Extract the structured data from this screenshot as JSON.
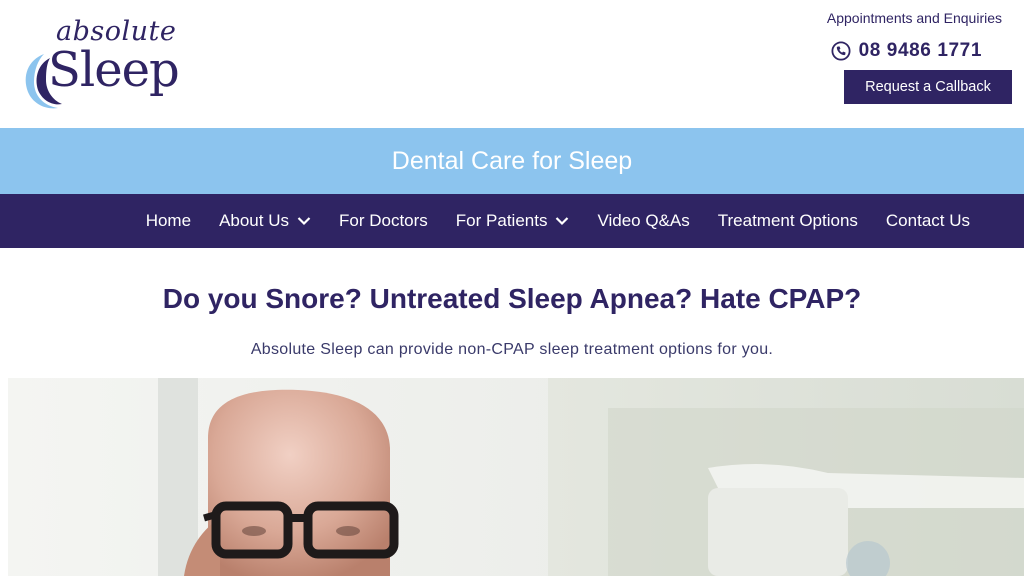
{
  "logo": {
    "line1": "absolute",
    "line2": "Sleep"
  },
  "contact": {
    "enquiries_label": "Appointments and Enquiries",
    "phone": "08 9486 1771",
    "callback_label": "Request a Callback"
  },
  "tagline": "Dental Care for Sleep",
  "nav": {
    "items": [
      {
        "label": "Home",
        "has_dropdown": false
      },
      {
        "label": "About Us",
        "has_dropdown": true
      },
      {
        "label": "For Doctors",
        "has_dropdown": false
      },
      {
        "label": "For Patients",
        "has_dropdown": true
      },
      {
        "label": "Video Q&As",
        "has_dropdown": false
      },
      {
        "label": "Treatment Options",
        "has_dropdown": false
      },
      {
        "label": "Contact Us",
        "has_dropdown": false
      }
    ]
  },
  "hero": {
    "headline": "Do you Snore? Untreated Sleep Apnea? Hate CPAP?",
    "subline": "Absolute Sleep can provide non-CPAP sleep treatment options for you."
  },
  "colors": {
    "brand_navy": "#2f2463",
    "tagline_blue": "#8cc4ee",
    "moon_light": "#8cc4ee",
    "moon_dark": "#2f2463"
  },
  "icons": {
    "phone": "phone-icon",
    "chevron": "chevron-down-icon",
    "moon": "moon-logo-icon"
  }
}
